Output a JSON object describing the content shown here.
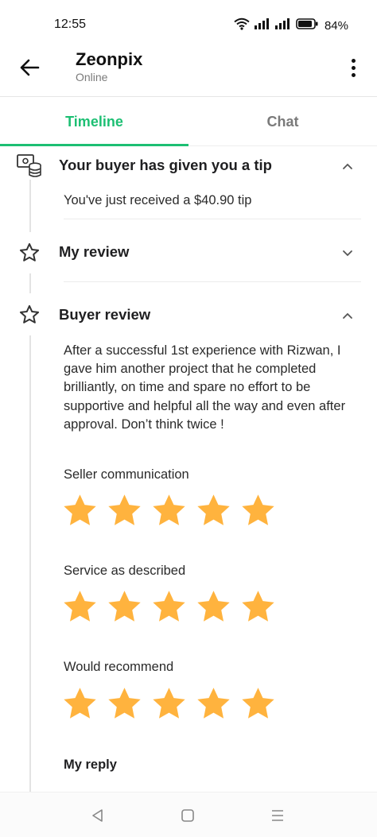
{
  "status_bar": {
    "time": "12:55",
    "battery": "84%"
  },
  "header": {
    "title": "Zeonpix",
    "subtitle": "Online"
  },
  "tabs": [
    {
      "label": "Timeline"
    },
    {
      "label": "Chat"
    }
  ],
  "tip_section": {
    "title": "Your buyer has given you a tip",
    "message": "You've just received a $40.90 tip",
    "icon": "payment-icon"
  },
  "my_review": {
    "title": "My review",
    "icon": "star-outline-icon"
  },
  "buyer_review": {
    "title": "Buyer review",
    "icon": "star-outline-icon",
    "text": "After a successful 1st experience with Rizwan, I gave him another project that he completed brilliantly, on time and spare no effort to be supportive and helpful all the way and even after approval. Don’t think twice !",
    "ratings": [
      {
        "label": "Seller communication",
        "stars": 5,
        "max": 5
      },
      {
        "label": "Service as described",
        "stars": 5,
        "max": 5
      },
      {
        "label": "Would recommend",
        "stars": 5,
        "max": 5
      }
    ],
    "reply_label": "My reply"
  },
  "colors": {
    "accent": "#1dbf73",
    "star": "#ffb33e"
  }
}
